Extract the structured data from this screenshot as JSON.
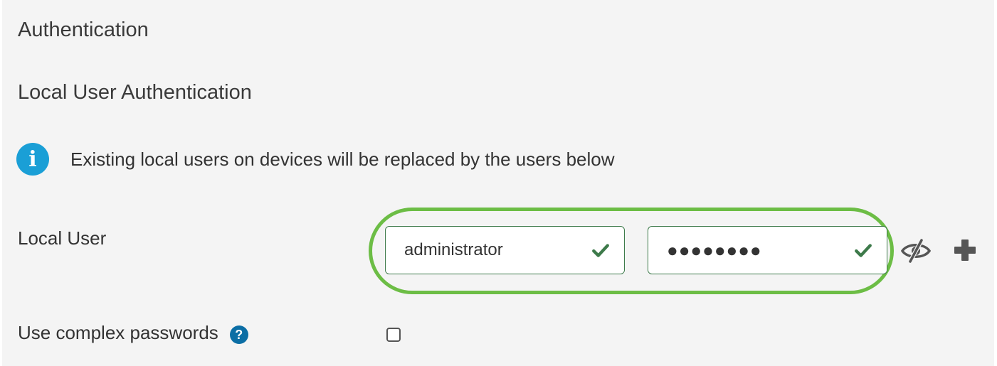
{
  "section": {
    "title": "Authentication"
  },
  "local_auth": {
    "title": "Local User Authentication",
    "info_text": "Existing local users on devices will be replaced by the users below",
    "local_user_label": "Local User",
    "username_value": "administrator",
    "password_value": "●●●●●●●●",
    "complex_passwords_label": "Use complex passwords",
    "complex_passwords_checked": false
  },
  "icons": {
    "info": "info-icon",
    "valid": "check-icon",
    "toggle_visibility": "eye-slash-icon",
    "add": "plus-icon",
    "help": "help-icon"
  },
  "colors": {
    "panel_bg": "#f4f4f4",
    "info_blue": "#1a9fd6",
    "help_blue": "#0b6ea5",
    "valid_green": "#3d7a4a",
    "highlight_green": "#6cbd45"
  }
}
